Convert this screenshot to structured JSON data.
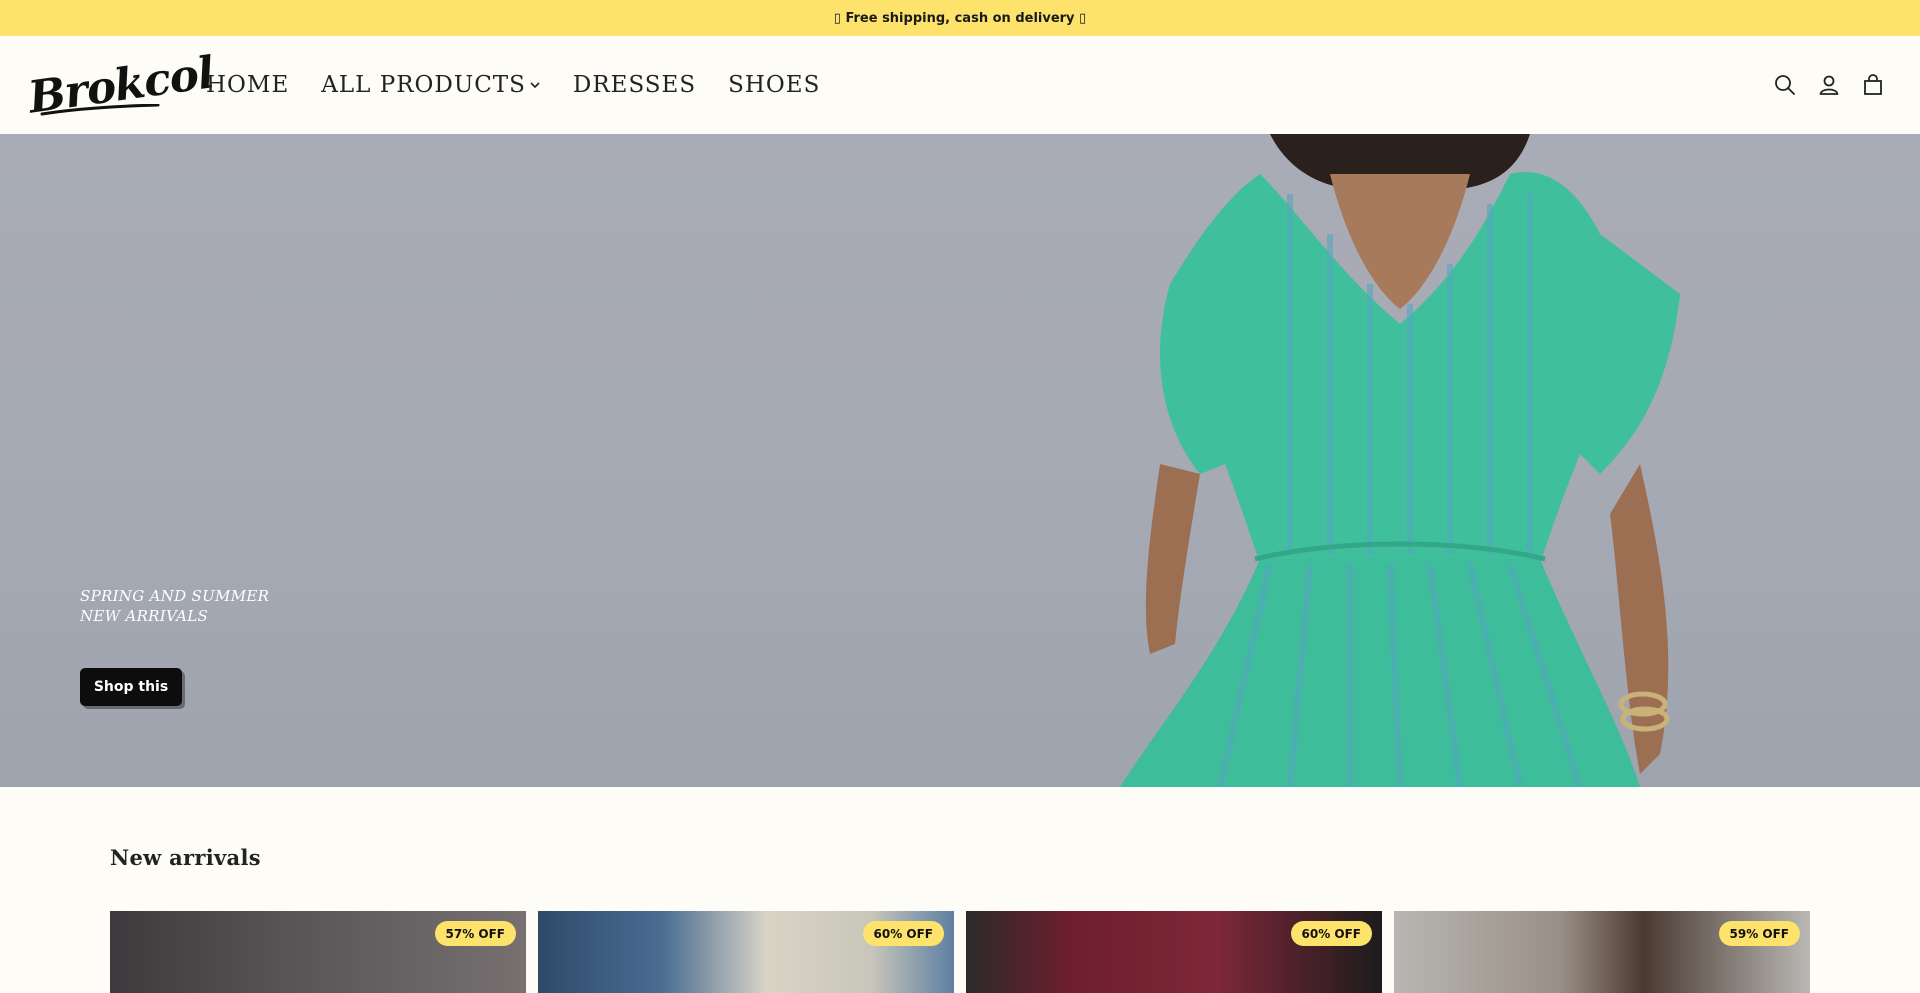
{
  "announcement": {
    "text": "▯ Free shipping, cash on delivery ▯"
  },
  "header": {
    "logo_text": "Brokcol",
    "nav": [
      {
        "label": "HOME"
      },
      {
        "label": "ALL PRODUCTS",
        "has_dropdown": true
      },
      {
        "label": "DRESSES"
      },
      {
        "label": "SHOES"
      }
    ],
    "icons": [
      "search-icon",
      "account-icon",
      "cart-icon"
    ]
  },
  "hero": {
    "line1": "SPRING AND SUMMER",
    "line2": "NEW ARRIVALS",
    "button_label": "Shop this"
  },
  "new_arrivals": {
    "title": "New arrivals",
    "products": [
      {
        "badge": "57% OFF"
      },
      {
        "badge": "60% OFF"
      },
      {
        "badge": "60% OFF"
      },
      {
        "badge": "59% OFF"
      }
    ]
  },
  "colors": {
    "announcement_bg": "#fde26c",
    "badge_bg": "#fde26c",
    "button_bg": "#0d0d0d",
    "page_bg": "#fdfcf7"
  }
}
